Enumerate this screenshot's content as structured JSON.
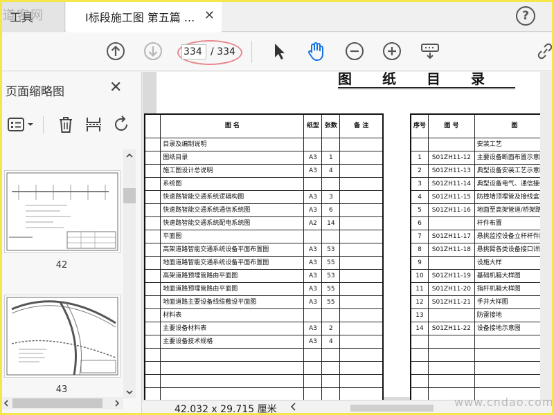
{
  "tabs": {
    "tools_label": "工具",
    "doc_title": "I标段施工图 第五篇 ...",
    "close_symbol": "✕"
  },
  "help_symbol": "?",
  "watermark_top": "道客网",
  "watermark_bottom": "www.cndao.com",
  "toolbar": {
    "page_current": "334",
    "page_total": "/ 334",
    "icons": [
      "prev-page-icon",
      "next-page-icon",
      "select-cursor-icon",
      "hand-tool-icon",
      "zoom-out-icon",
      "zoom-in-icon",
      "stamp-icon",
      "link-icon"
    ]
  },
  "sidebar": {
    "title": "页面缩略图",
    "close_symbol": "✕",
    "thumbnails": [
      {
        "label": "42"
      },
      {
        "label": "43"
      }
    ]
  },
  "document": {
    "title": "图纸目录",
    "left_table": {
      "headers": [
        "",
        "图 名",
        "纸型",
        "张数",
        "备 注"
      ],
      "rows": [
        [
          "",
          "目录及编制说明",
          "",
          "",
          ""
        ],
        [
          "",
          "图纸目录",
          "A3",
          "1",
          ""
        ],
        [
          "",
          "施工图设计总说明",
          "A3",
          "4",
          ""
        ],
        [
          "",
          "系统图",
          "",
          "",
          ""
        ],
        [
          "",
          "快速路智能交通系统逻辑构图",
          "A3",
          "3",
          ""
        ],
        [
          "",
          "快速路智能交通系统通信系统图",
          "A3",
          "6",
          ""
        ],
        [
          "",
          "快速路智能交通系统配电系统图",
          "A2",
          "14",
          ""
        ],
        [
          "",
          "平面图",
          "",
          "",
          ""
        ],
        [
          "",
          "高架道路智能交通系统设备平面布置图",
          "A3",
          "53",
          ""
        ],
        [
          "",
          "地面道路智能交通系统设备平面布置图",
          "A3",
          "55",
          ""
        ],
        [
          "",
          "高架道路预埋管路由平面图",
          "A3",
          "53",
          ""
        ],
        [
          "",
          "地面道路预埋管路由平面图",
          "A3",
          "55",
          ""
        ],
        [
          "",
          "地面道路主要设备线缆敷设平面图",
          "A3",
          "55",
          ""
        ],
        [
          "",
          "材料表",
          "",
          "",
          ""
        ],
        [
          "",
          "主要设备材料表",
          "A3",
          "2",
          ""
        ],
        [
          "",
          "主要设备技术规格",
          "A3",
          "4",
          ""
        ],
        [
          "",
          "",
          "",
          "",
          ""
        ],
        [
          "",
          "",
          "",
          "",
          ""
        ],
        [
          "",
          "",
          "",
          "",
          ""
        ],
        [
          "",
          "",
          "",
          "",
          ""
        ],
        [
          "",
          "",
          "",
          "",
          ""
        ],
        [
          "",
          "",
          "",
          "",
          ""
        ]
      ]
    },
    "right_table": {
      "headers": [
        "序号",
        "图 号",
        "图"
      ],
      "rows": [
        [
          "",
          "",
          "安装工艺"
        ],
        [
          "1",
          "S01ZH11-12",
          "主要设备断面布置示意图"
        ],
        [
          "2",
          "S01ZH11-13",
          "典型设备安装工艺示意图"
        ],
        [
          "3",
          "S01ZH11-14",
          "典型设备电气、通信接线图"
        ],
        [
          "4",
          "S01ZH11-15",
          "防撞墙顶埋管及接线盒型式"
        ],
        [
          "5",
          "S01ZH11-16",
          "地面至高架管道/桥架路由"
        ],
        [
          "6",
          "",
          "杆件布置"
        ],
        [
          "7",
          "S01ZH11-17",
          "悬挑监控设备立杆杆件图"
        ],
        [
          "8",
          "S01ZH11-18",
          "悬挑臂各类设备接口详图"
        ],
        [
          "9",
          "",
          "设施大样"
        ],
        [
          "10",
          "S01ZH11-19",
          "基础机箱大样图"
        ],
        [
          "11",
          "S01ZH11-20",
          "指杆机箱大样图"
        ],
        [
          "12",
          "S01ZH11-21",
          "手井大样图"
        ],
        [
          "13",
          "",
          "防雷接地"
        ],
        [
          "14",
          "S01ZH11-22",
          "设备接地示意图"
        ],
        [
          "",
          "",
          ""
        ],
        [
          "",
          "",
          ""
        ],
        [
          "",
          "",
          ""
        ],
        [
          "",
          "",
          ""
        ],
        [
          "",
          "",
          ""
        ],
        [
          "",
          "",
          ""
        ],
        [
          "",
          "",
          ""
        ]
      ]
    }
  },
  "status": {
    "page_size": "42.032 x 29.715 厘米"
  }
}
